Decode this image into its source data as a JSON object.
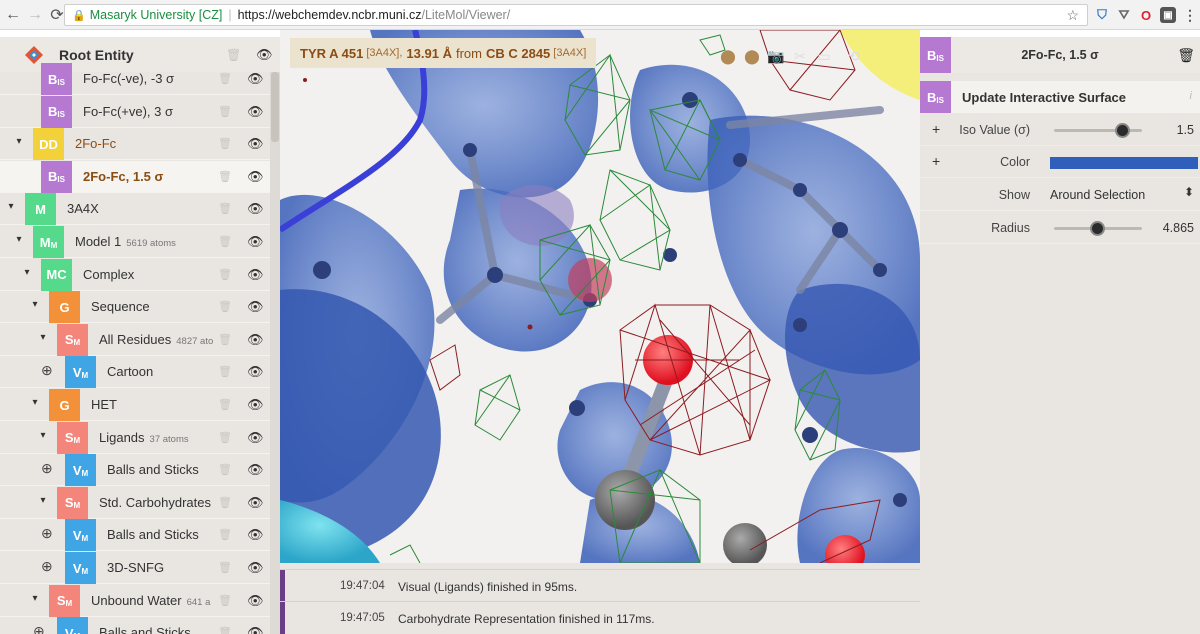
{
  "browser": {
    "secure_label": "Masaryk University [CZ]",
    "url_host": "https://webchemdev.ncbr.muni.cz",
    "url_path": "/LiteMol/Viewer/"
  },
  "tree": {
    "root_label": "Root Entity",
    "rows": [
      {
        "badge": "B",
        "sub": "IS",
        "label": "Fo-Fc(-ve), -3 σ",
        "meta": ""
      },
      {
        "badge": "B",
        "sub": "IS",
        "label": "Fo-Fc(+ve), 3 σ",
        "meta": ""
      },
      {
        "badge": "DD",
        "sub": "",
        "label": "2Fo-Fc",
        "meta": ""
      },
      {
        "badge": "B",
        "sub": "IS",
        "label": "2Fo-Fc, 1.5 σ",
        "meta": ""
      },
      {
        "badge": "M",
        "sub": "",
        "label": "3A4X",
        "meta": ""
      },
      {
        "badge": "M",
        "sub": "M",
        "label": "Model 1",
        "meta": "5619 atoms"
      },
      {
        "badge": "MC",
        "sub": "",
        "label": "Complex",
        "meta": ""
      },
      {
        "badge": "G",
        "sub": "",
        "label": "Sequence",
        "meta": ""
      },
      {
        "badge": "S",
        "sub": "M",
        "label": "All Residues",
        "meta": "4827 ato"
      },
      {
        "badge": "V",
        "sub": "M",
        "label": "Cartoon",
        "meta": ""
      },
      {
        "badge": "G",
        "sub": "",
        "label": "HET",
        "meta": ""
      },
      {
        "badge": "S",
        "sub": "M",
        "label": "Ligands",
        "meta": "37 atoms"
      },
      {
        "badge": "V",
        "sub": "M",
        "label": "Balls and Sticks",
        "meta": ""
      },
      {
        "badge": "S",
        "sub": "M",
        "label": "Std. Carbohydrates",
        "meta": ""
      },
      {
        "badge": "V",
        "sub": "M",
        "label": "Balls and Sticks",
        "meta": ""
      },
      {
        "badge": "V",
        "sub": "M",
        "label": "3D-SNFG",
        "meta": ""
      },
      {
        "badge": "S",
        "sub": "M",
        "label": "Unbound Water",
        "meta": "641 a"
      },
      {
        "badge": "V",
        "sub": "M",
        "label": "Balls and Sticks",
        "meta": ""
      }
    ]
  },
  "viewer": {
    "highlight_res": "TYR A 451",
    "highlight_res_tag": "[3A4X],",
    "highlight_dist": "13.91 Å",
    "highlight_from": "from",
    "highlight_atom": "CB C 2845",
    "highlight_atom_tag": "[3A4X]"
  },
  "log": [
    {
      "time": "19:47:04",
      "message": "Visual (Ligands) finished in 95ms."
    },
    {
      "time": "19:47:05",
      "message": "Carbohydrate Representation finished in 117ms."
    }
  ],
  "right_panel": {
    "entity_badge": "B",
    "entity_badge_sub": "IS",
    "entity_title": "2Fo-Fc, 1.5 σ",
    "transform_title": "Update Interactive Surface",
    "iso_label": "Iso Value (σ)",
    "iso_value": "1.5",
    "iso_fraction": 0.78,
    "color_label": "Color",
    "color_hex": "#2f5fbb",
    "show_label": "Show",
    "show_value": "Around Selection",
    "radius_label": "Radius",
    "radius_value": "4.865",
    "radius_fraction": 0.49
  }
}
